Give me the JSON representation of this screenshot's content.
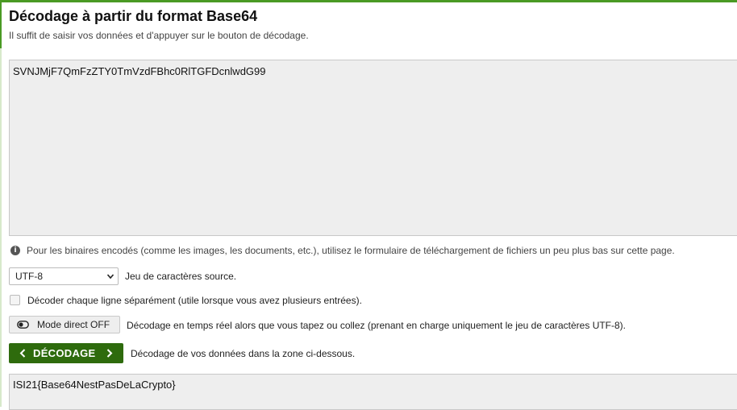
{
  "header": {
    "title": "Décodage à partir du format Base64",
    "subtitle": "Il suffit de saisir vos données et d'appuyer sur le bouton de décodage."
  },
  "input": {
    "value": "SVNJMjF7QmFzZTY0TmVzdFBhc0RlTGFDcnlwdG99"
  },
  "info": {
    "icon": "info-icon",
    "text": "Pour les binaires encodés (comme les images, les documents, etc.), utilisez le formulaire de téléchargement de fichiers un peu plus bas sur cette page."
  },
  "charset": {
    "selected": "UTF-8",
    "label": "Jeu de caractères source."
  },
  "line_by_line": {
    "checked": false,
    "label": "Décoder chaque ligne séparément (utile lorsque vous avez plusieurs entrées)."
  },
  "live_mode": {
    "button_label": "Mode direct OFF",
    "description": "Décodage en temps réel alors que vous tapez ou collez (prenant en charge uniquement le jeu de caractères UTF-8)."
  },
  "decode": {
    "button_label": "DÉCODAGE",
    "description": "Décodage de vos données dans la zone ci-dessous."
  },
  "output": {
    "value": "ISI21{Base64NestPasDeLaCrypto}"
  },
  "colors": {
    "accent": "#4a9a24",
    "button_primary": "#2e6b0d",
    "panel_bg": "#eeeeee"
  }
}
